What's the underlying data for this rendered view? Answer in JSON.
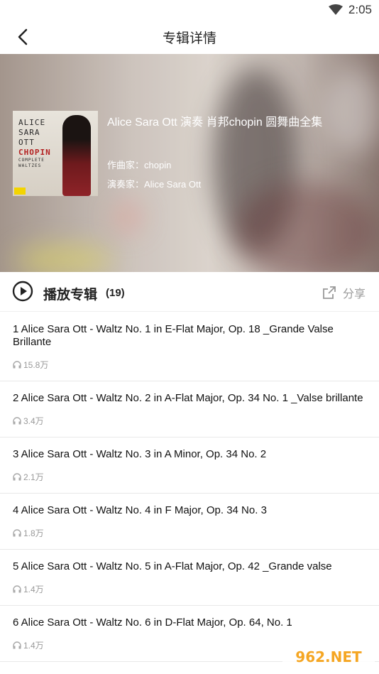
{
  "status": {
    "time": "2:05",
    "wifi_icon": "wifi-icon"
  },
  "header": {
    "title": "专辑详情",
    "back_icon": "back-arrow-icon"
  },
  "album": {
    "title": "Alice Sara Ott 演奏 肖邦chopin 圆舞曲全集",
    "composer": "作曲家：chopin",
    "performer": "演奏家：Alice Sara Ott",
    "cover": {
      "line1": "ALICE",
      "line2": "SARA",
      "line3": "OTT",
      "line4": "CHOPIN",
      "line5": "COMPLETE",
      "line6": "WALTZES"
    }
  },
  "play_row": {
    "label": "播放专辑",
    "count": "(19)",
    "share_label": "分享"
  },
  "tracks": [
    {
      "name": "1 Alice Sara Ott - Waltz No. 1 in E-Flat Major, Op. 18 _Grande Valse Brillante",
      "plays": "15.8万"
    },
    {
      "name": "2 Alice Sara Ott - Waltz No. 2 in A-Flat Major, Op. 34 No. 1 _Valse brillante",
      "plays": "3.4万"
    },
    {
      "name": "3 Alice Sara Ott - Waltz No. 3 in A Minor, Op. 34 No. 2",
      "plays": "2.1万"
    },
    {
      "name": "4 Alice Sara Ott - Waltz No. 4 in F Major, Op. 34 No. 3",
      "plays": "1.8万"
    },
    {
      "name": "5 Alice Sara Ott - Waltz No. 5 in A-Flat Major, Op. 42 _Grande valse",
      "plays": "1.4万"
    },
    {
      "name": "6 Alice Sara Ott - Waltz No. 6 in D-Flat Major, Op. 64, No. 1",
      "plays": "1.4万"
    }
  ],
  "watermark": {
    "text": "962.NET"
  },
  "colors": {
    "accent": "#222222",
    "muted": "#999999",
    "divider": "#e8e8e8"
  }
}
